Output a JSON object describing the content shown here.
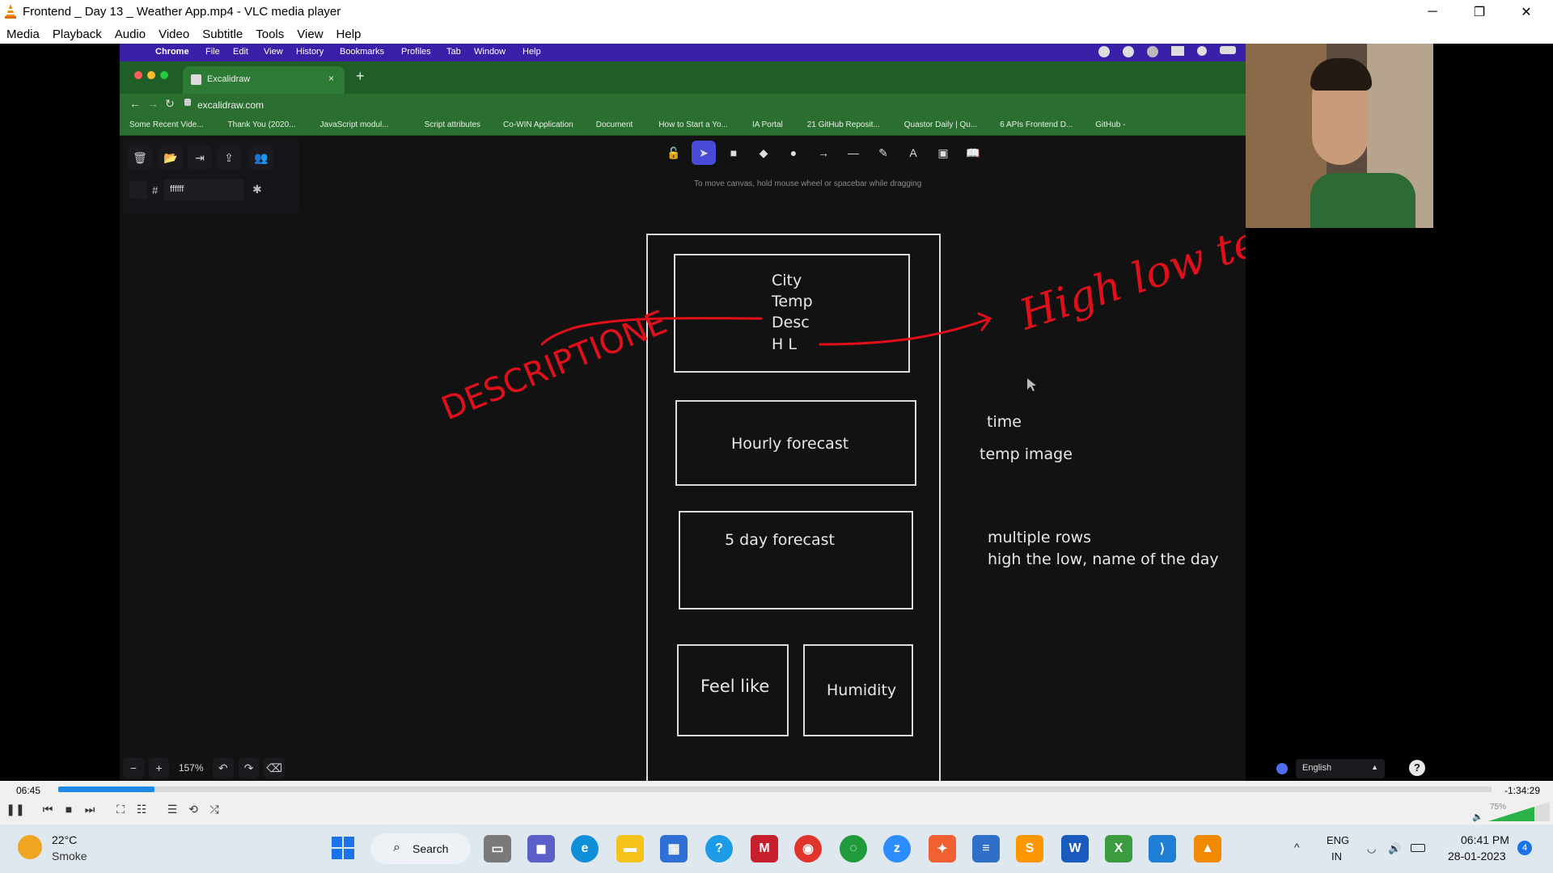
{
  "window": {
    "title": "Frontend _ Day 13 _ Weather App.mp4 - VLC media player",
    "minimize_glyph": "─",
    "restore_glyph": "❐",
    "close_glyph": "✕"
  },
  "menu": [
    "Media",
    "Playback",
    "Audio",
    "Video",
    "Subtitle",
    "Tools",
    "View",
    "Help"
  ],
  "mac_menu": {
    "apple": "",
    "items": [
      "Chrome",
      "File",
      "Edit",
      "View",
      "History",
      "Bookmarks",
      "Profiles",
      "Tab",
      "Window",
      "Help"
    ]
  },
  "browser": {
    "tab_title": "Excalidraw",
    "new_tab": "+",
    "url": "excalidraw.com",
    "bookmarks": [
      "Some Recent Vide...",
      "Thank You (2020...",
      "JavaScript modul...",
      "Script attributes",
      "Co-WIN Application",
      "Document",
      "How to Start a Yo...",
      "IA Portal",
      "21 GitHub Reposit...",
      "Quastor Daily | Qu...",
      "6 APIs Frontend D...",
      "GitHub -"
    ]
  },
  "excalidraw": {
    "hint": "To move canvas, hold mouse wheel or spacebar while dragging",
    "color_hash": "#",
    "color_value": "ffffff",
    "zoom": "157%",
    "language": "English",
    "help": "?"
  },
  "drawing": {
    "header_lines": [
      "City",
      "Temp",
      "Desc",
      "H L"
    ],
    "hourly": "Hourly forecast",
    "five_day": "5 day forecast",
    "feel_like": "Feel like",
    "humidity": "Humidity",
    "note_time": "time",
    "note_temp_image": "temp image",
    "note_rows_1": "multiple rows",
    "note_rows_2": "high the low, name of the day",
    "red_left": "DESCRIPTIONE",
    "red_right": "High low temp"
  },
  "player": {
    "elapsed": "06:45",
    "remaining": "-1:34:29",
    "volume": "75%",
    "progress": 0.067
  },
  "taskbar": {
    "weather_temp": "22°C",
    "weather_desc": "Smoke",
    "search": "Search",
    "lang_1": "ENG",
    "lang_2": "IN",
    "time": "06:41 PM",
    "date": "28-01-2023",
    "notif_count": "4"
  },
  "colors": {
    "mac_menubar": "#3a1fa8",
    "chrome_green": "#2a6f30",
    "canvas": "#121212",
    "annotation_red": "#e0101a",
    "seek_fill": "#1e88e5"
  }
}
